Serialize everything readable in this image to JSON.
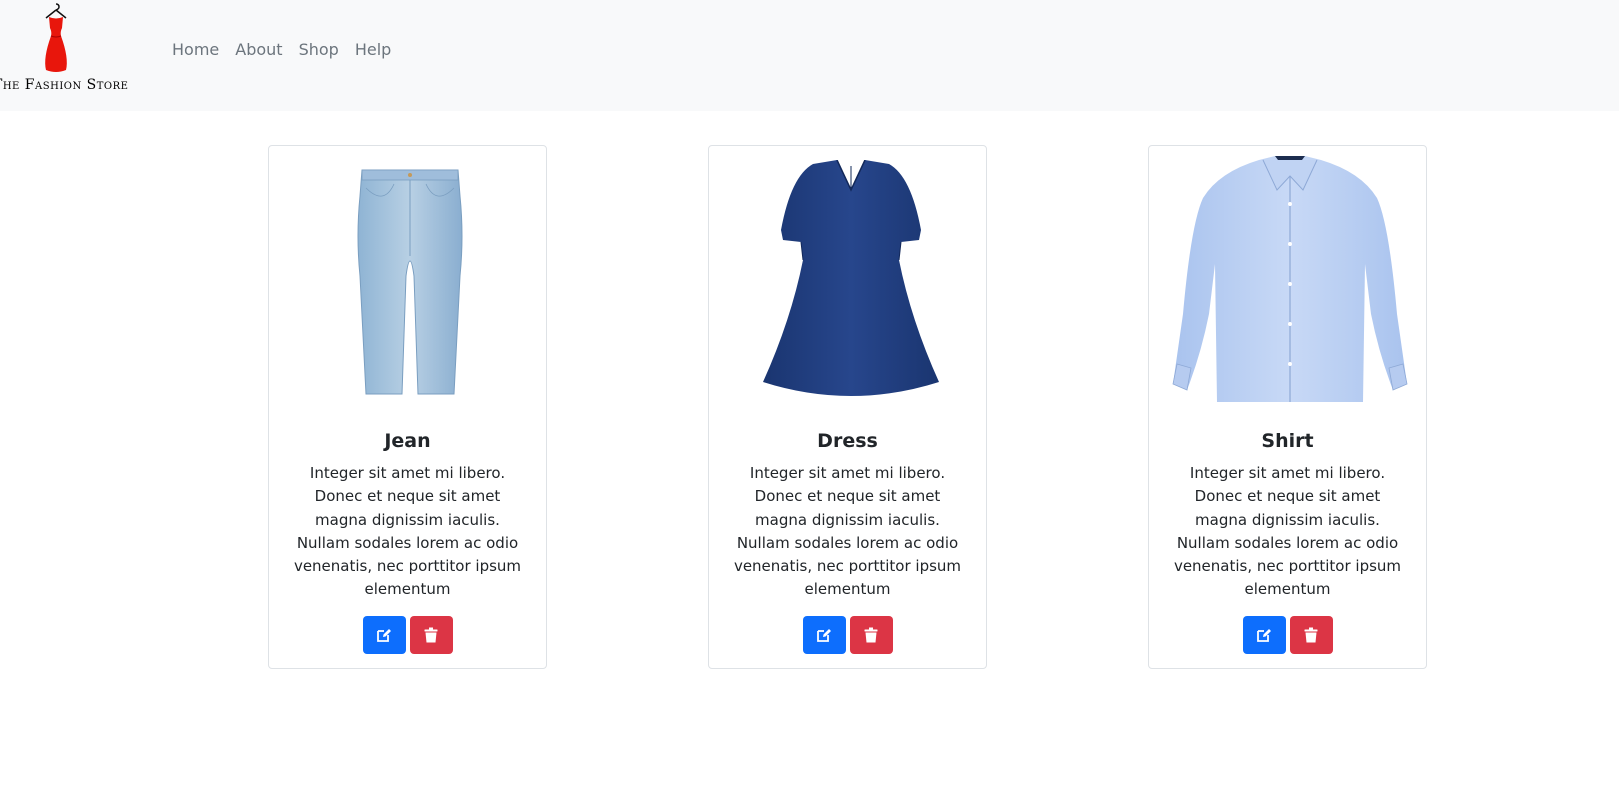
{
  "brand": {
    "name": "The Fashion Store"
  },
  "nav": {
    "items": [
      {
        "label": "Home"
      },
      {
        "label": "About"
      },
      {
        "label": "Shop"
      },
      {
        "label": "Help"
      }
    ]
  },
  "products": [
    {
      "title": "Jean",
      "description": "Integer sit amet mi libero. Donec et neque sit amet magna dignissim iaculis. Nullam sodales lorem ac odio venenatis, nec porttitor ipsum elementum",
      "image_icon": "jeans-image"
    },
    {
      "title": "Dress",
      "description": "Integer sit amet mi libero. Donec et neque sit amet magna dignissim iaculis. Nullam sodales lorem ac odio venenatis, nec porttitor ipsum elementum",
      "image_icon": "dress-image"
    },
    {
      "title": "Shirt",
      "description": "Integer sit amet mi libero. Donec et neque sit amet magna dignissim iaculis. Nullam sodales lorem ac odio venenatis, nec porttitor ipsum elementum",
      "image_icon": "shirt-image"
    }
  ],
  "actions": {
    "edit_icon": "edit-icon",
    "delete_icon": "trash-icon"
  },
  "colors": {
    "navbar_bg": "#f8f9fa",
    "edit": "#0d6efd",
    "delete": "#dc3545",
    "logo_dress": "#e8160c"
  }
}
